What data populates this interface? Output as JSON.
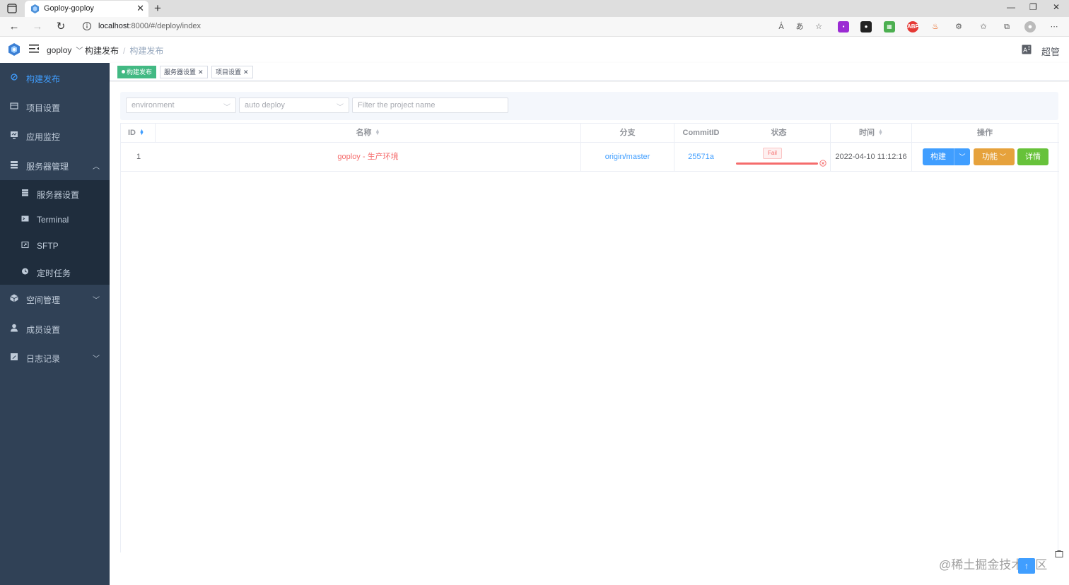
{
  "browser": {
    "tab_title": "Goploy-goploy",
    "url_host": "localhost",
    "url_path": ":8000/#/deploy/index"
  },
  "header": {
    "space": "goploy",
    "breadcrumb": [
      "构建发布",
      "构建发布"
    ],
    "user": "超管"
  },
  "sidebar": {
    "items": [
      {
        "label": "构建发布",
        "icon": "deploy-icon"
      },
      {
        "label": "项目设置",
        "icon": "project-icon"
      },
      {
        "label": "应用监控",
        "icon": "monitor-icon"
      },
      {
        "label": "服务器管理",
        "icon": "server-icon"
      },
      {
        "label": "空间管理",
        "icon": "namespace-icon"
      },
      {
        "label": "成员设置",
        "icon": "member-icon"
      },
      {
        "label": "日志记录",
        "icon": "log-icon"
      }
    ],
    "sub_items": [
      {
        "label": "服务器设置",
        "icon": "server-setting-icon"
      },
      {
        "label": "Terminal",
        "icon": "terminal-icon"
      },
      {
        "label": "SFTP",
        "icon": "sftp-icon"
      },
      {
        "label": "定时任务",
        "icon": "crontab-icon"
      }
    ]
  },
  "tags": [
    "构建发布",
    "服务器设置",
    "项目设置"
  ],
  "filters": {
    "environment_placeholder": "environment",
    "auto_deploy_placeholder": "auto deploy",
    "project_name_placeholder": "Filter the project name"
  },
  "table": {
    "columns": [
      "ID",
      "名称",
      "分支",
      "CommitID",
      "状态",
      "时间",
      "操作"
    ],
    "rows": [
      {
        "id": "1",
        "name": "goploy - 生产环境",
        "branch": "origin/master",
        "commit": "25571a",
        "status": "Fail",
        "progress": 100,
        "time": "2022-04-10 11:12:16",
        "actions": {
          "build": "构建",
          "func": "功能",
          "detail": "详情"
        }
      }
    ]
  },
  "watermark": "@稀土掘金技术社区",
  "colors": {
    "sidebar_bg": "#304156",
    "submenu_bg": "#1f2d3d",
    "active": "#409eff",
    "tag_active": "#42b983",
    "danger": "#f56c6c",
    "warning": "#e6a23c",
    "success": "#67c23a"
  }
}
